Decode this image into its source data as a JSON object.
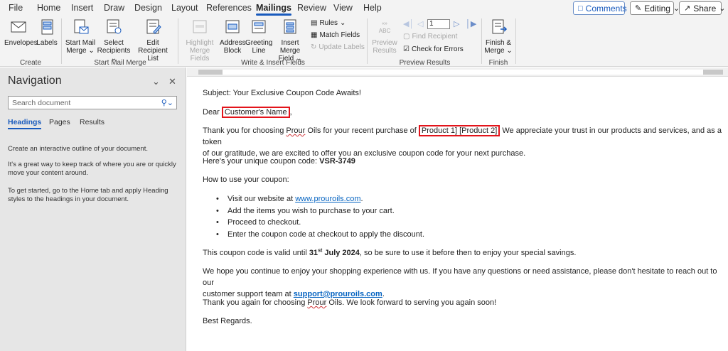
{
  "menu": {
    "tabs": [
      "File",
      "Home",
      "Insert",
      "Draw",
      "Design",
      "Layout",
      "References",
      "Mailings",
      "Review",
      "View",
      "Help"
    ],
    "active": "Mailings",
    "comments_label": "Comments",
    "editing_label": "Editing",
    "share_label": "Share"
  },
  "ribbon": {
    "create": {
      "envelopes": "Envelopes",
      "labels": "Labels",
      "group": "Create"
    },
    "start": {
      "start_mail_merge_1": "Start Mail",
      "start_mail_merge_2": "Merge",
      "select_recipients_1": "Select",
      "select_recipients_2": "Recipients",
      "edit_list_1": "Edit",
      "edit_list_2": "Recipient List",
      "group": "Start Mail Merge"
    },
    "write": {
      "highlight_1": "Highlight",
      "highlight_2": "Merge Fields",
      "address_1": "Address",
      "address_2": "Block",
      "greeting_1": "Greeting",
      "greeting_2": "Line",
      "insert_1": "Insert Merge",
      "insert_2": "Field",
      "rules": "Rules",
      "match": "Match Fields",
      "update": "Update Labels",
      "group": "Write & Insert Fields"
    },
    "preview": {
      "preview_1": "Preview",
      "preview_2": "Results",
      "record": "1",
      "find": "Find Recipient",
      "check": "Check for Errors",
      "group": "Preview Results"
    },
    "finish": {
      "finish_1": "Finish &",
      "finish_2": "Merge",
      "group": "Finish"
    }
  },
  "nav": {
    "title": "Navigation",
    "search_placeholder": "Search document",
    "tabs": [
      "Headings",
      "Pages",
      "Results"
    ],
    "active_tab": "Headings",
    "text1": "Create an interactive outline of your document.",
    "text2": "It's a great way to keep track of where you are or quickly move your content around.",
    "text3": "To get started, go to the Home tab and apply Heading styles to the headings in your document."
  },
  "doc": {
    "subject": "Subject: Your Exclusive Coupon Code Awaits!",
    "dear": "Dear",
    "customer_name": "Customer's Name",
    "dear_end": ",",
    "thanks_a": "Thank you for choosing",
    "brand": "Prour",
    "thanks_b": "Oils for your recent purchase of",
    "products": "Product 1] [Product 2]",
    "thanks_c": "We appreciate your trust in our products and services, and as a token",
    "thanks_d": "of our gratitude, we are excited to offer you an exclusive coupon code for your next purchase.",
    "coupon_pre": "Here's your unique coupon code:",
    "coupon_code": "VSR-3749",
    "howto": "How to use your coupon:",
    "bullets": [
      "Visit our website at",
      "Add the items you wish to purchase to your cart.",
      "Proceed to checkout.",
      "Enter the coupon code at checkout to apply the discount."
    ],
    "website": "www.prouroils.com",
    "website_end": ".",
    "valid_a": "This coupon code is valid until",
    "valid_day": "31",
    "valid_sup": "st",
    "valid_month": "July 2024",
    "valid_b": ", so be sure to use it before then to enjoy your special savings.",
    "hope_a": "We hope you continue to enjoy your shopping experience with us. If you have any questions or need assistance, please don't hesitate to reach out to our",
    "hope_b": "customer support team at",
    "email": "support@prouroils.com",
    "hope_end": ".",
    "again_a": "Thank you again for choosing",
    "again_b": "Oils. We look forward to serving you again soon!",
    "regards": "Best Regards."
  },
  "colors": {
    "accent": "#185abd",
    "highlight_box": "#e3141b",
    "link": "#0563c1"
  }
}
